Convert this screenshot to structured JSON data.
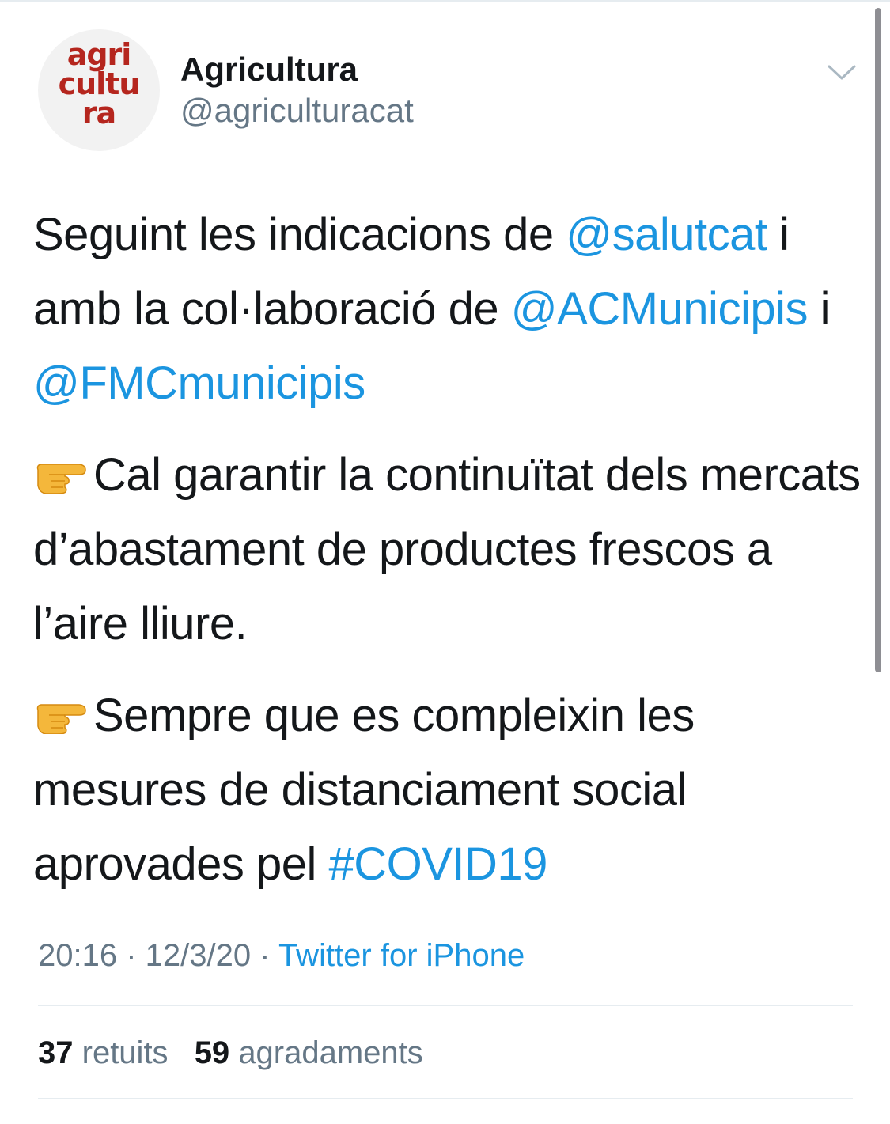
{
  "author": {
    "display_name": "Agricultura",
    "handle": "@agriculturacat",
    "avatar_logo_lines": [
      "agri",
      "cultu",
      "ra"
    ],
    "avatar_logo_color": "#b5261e"
  },
  "tweet": {
    "p1": {
      "t1": "Seguint les indicacions de ",
      "m1": "@salutcat",
      "t2": " i amb la col·laboració de ",
      "m2": "@ACMunicipis",
      "t3": " i ",
      "m3": "@FMCmunicipis"
    },
    "p2": {
      "emoji": "backhand-index-pointing-right",
      "text": "Cal garantir la continuïtat dels mercats d’abastament de productes frescos a l’aire lliure."
    },
    "p3": {
      "emoji": "backhand-index-pointing-right",
      "text": "Sempre que es compleixin les mesures de distanciament social aprovades pel ",
      "hashtag": "#COVID19"
    }
  },
  "meta": {
    "time": "20:16",
    "separator": " · ",
    "date": "12/3/20",
    "source": "Twitter for iPhone"
  },
  "stats": {
    "retweets_count": "37",
    "retweets_label": "retuits",
    "likes_count": "59",
    "likes_label": "agradaments"
  },
  "colors": {
    "link": "#1b95e0",
    "text": "#14171a",
    "secondary": "#657786",
    "divider": "#e6ecf0"
  },
  "icons": {
    "menu": "chevron-down-icon",
    "bullet": "pointing-hand-icon"
  }
}
